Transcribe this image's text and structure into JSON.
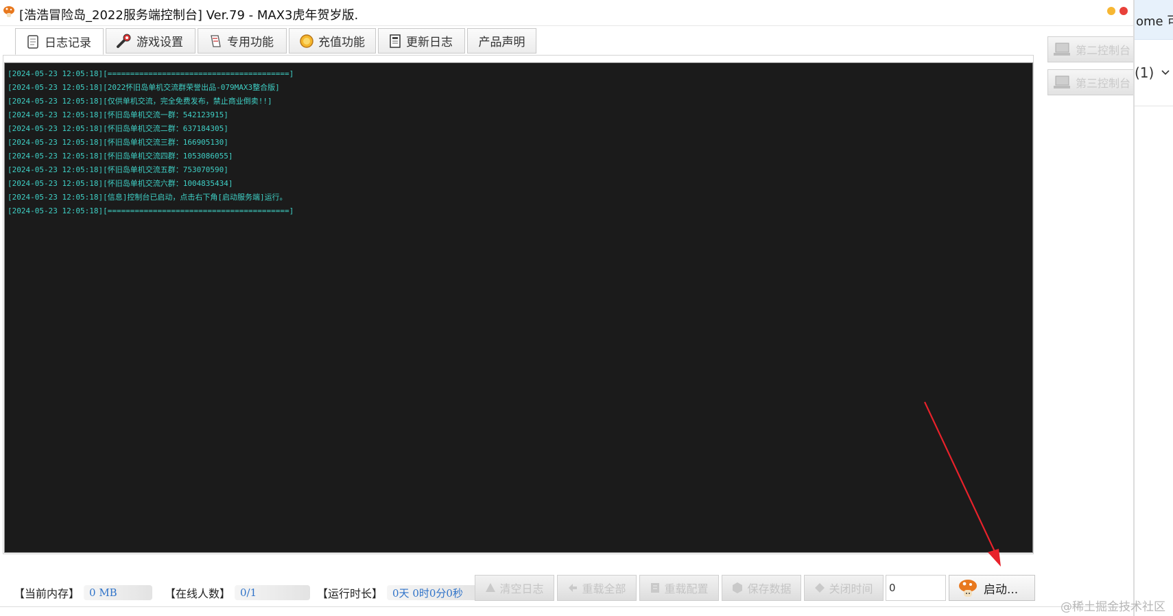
{
  "window": {
    "title": "[浩浩冒险岛_2022服务端控制台] Ver.79 - MAX3虎年贺岁版."
  },
  "tabs": [
    {
      "label": "日志记录",
      "icon": "notebook-icon"
    },
    {
      "label": "游戏设置",
      "icon": "wrench-icon"
    },
    {
      "label": "专用功能",
      "icon": "scroll-icon"
    },
    {
      "label": "充值功能",
      "icon": "coin-icon"
    },
    {
      "label": "更新日志",
      "icon": "document-icon"
    },
    {
      "label": "产品声明",
      "icon": ""
    }
  ],
  "log": [
    "[2024-05-23 12:05:18][========================================]",
    "[2024-05-23 12:05:18][2022怀旧岛单机交流群荣誉出品-079MAX3整合版]",
    "[2024-05-23 12:05:18][仅供单机交流，完全免费发布，禁止商业倒卖!!]",
    "[2024-05-23 12:05:18][怀旧岛单机交流一群：542123915]",
    "[2024-05-23 12:05:18][怀旧岛单机交流二群：637184305]",
    "[2024-05-23 12:05:18][怀旧岛单机交流三群：166905130]",
    "[2024-05-23 12:05:18][怀旧岛单机交流四群：1053086055]",
    "[2024-05-23 12:05:18][怀旧岛单机交流五群：753070590]",
    "[2024-05-23 12:05:18][怀旧岛单机交流六群：1004835434]",
    "[2024-05-23 12:05:18][信息]控制台已启动，点击右下角[启动服务端]运行。",
    "[2024-05-23 12:05:18][========================================]"
  ],
  "side_buttons": [
    {
      "label": "第二控制台"
    },
    {
      "label": "第三控制台"
    }
  ],
  "overlay": {
    "top_text": "ome 可",
    "sub_text": "(1)"
  },
  "status": {
    "memory_label": "【当前内存】",
    "memory_value": "0 MB",
    "online_label": "【在线人数】",
    "online_value": "0/1",
    "uptime_label": "【运行时长】",
    "uptime_value": "0天 0时0分0秒"
  },
  "actions": {
    "clear_log": "清空日志",
    "reload_all": "重载全部",
    "reload_config": "重载配置",
    "save_data": "保存数据",
    "close_time": "关闭时间",
    "time_value": "0",
    "start": "启动..."
  },
  "watermark": "@稀土掘金技术社区",
  "colors": {
    "console_bg": "#1b1b1b",
    "console_text": "#3fd0c6",
    "status_value": "#2f73c9",
    "arrow": "#e8222b"
  }
}
